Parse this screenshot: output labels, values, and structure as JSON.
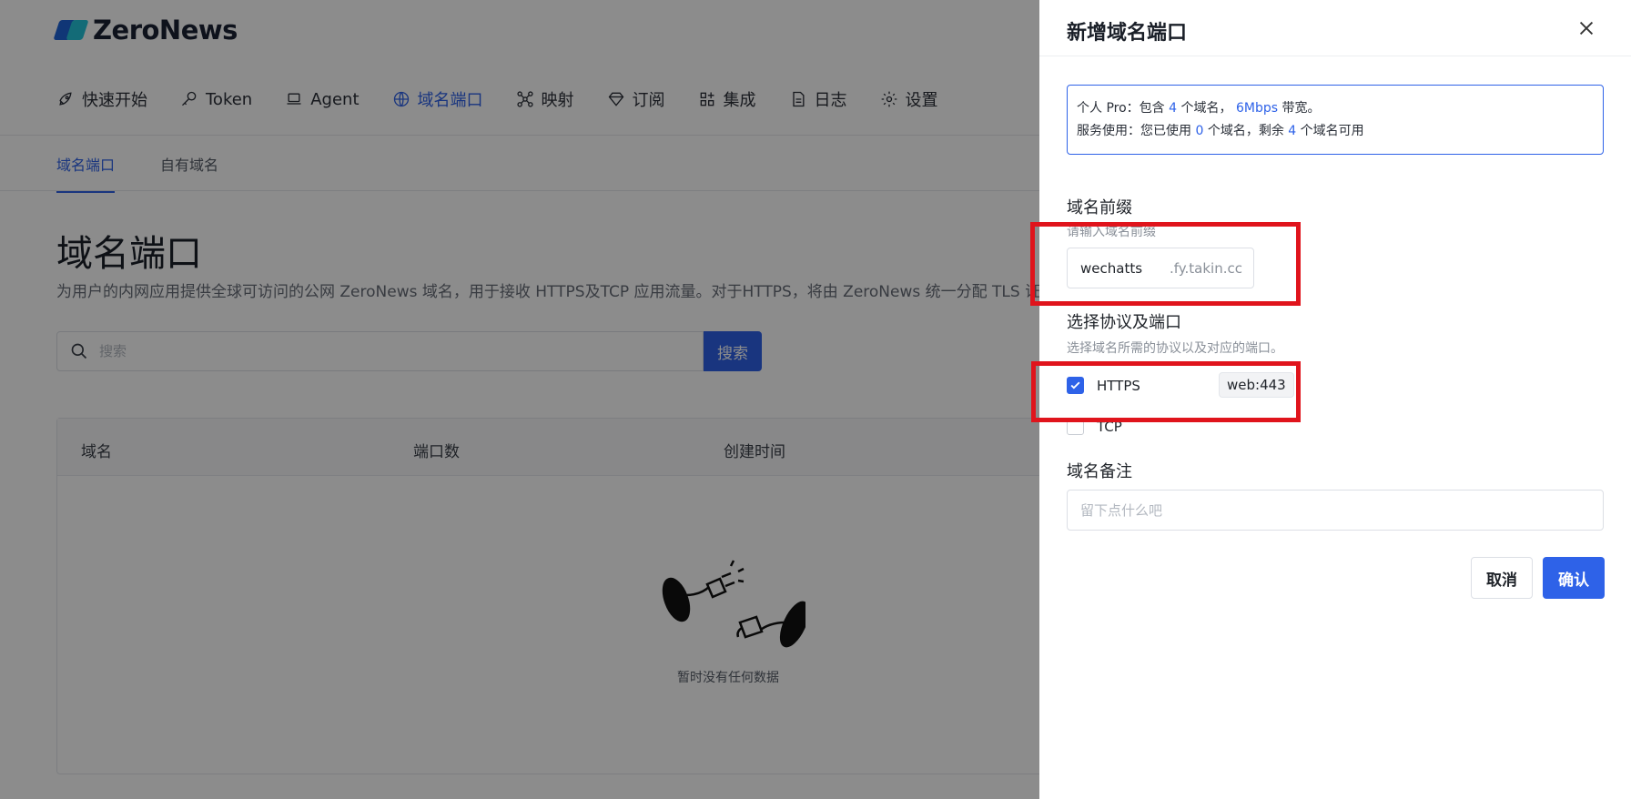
{
  "brand": {
    "name": "ZeroNews"
  },
  "topnav": [
    {
      "label": "快速开始",
      "icon": "rocket-icon"
    },
    {
      "label": "Token",
      "icon": "key-icon"
    },
    {
      "label": "Agent",
      "icon": "laptop-icon"
    },
    {
      "label": "域名端口",
      "icon": "globe-icon",
      "active": true
    },
    {
      "label": "映射",
      "icon": "network-icon"
    },
    {
      "label": "订阅",
      "icon": "diamond-icon"
    },
    {
      "label": "集成",
      "icon": "grid-plus-icon"
    },
    {
      "label": "日志",
      "icon": "document-icon"
    },
    {
      "label": "设置",
      "icon": "gear-icon"
    }
  ],
  "subtabs": [
    {
      "label": "域名端口",
      "active": true
    },
    {
      "label": "自有域名"
    }
  ],
  "page": {
    "title": "域名端口",
    "description": "为用户的内网应用提供全球可访问的公网 ZeroNews 域名，用于接收 HTTPS及TCP 应用流量。对于HTTPS，将由 ZeroNews 统一分配 TLS 证"
  },
  "search": {
    "placeholder": "搜索",
    "button_label": "搜索"
  },
  "table": {
    "columns": [
      "域名",
      "端口数",
      "创建时间"
    ],
    "empty_text": "暂时没有任何数据"
  },
  "drawer": {
    "title": "新增域名端口",
    "info": {
      "line1_a": "个人 Pro：包含 ",
      "line1_count": "4",
      "line1_b": " 个域名， ",
      "line1_bw": "6Mbps",
      "line1_c": " 带宽。",
      "line2_a": "服务使用：您已使用 ",
      "line2_used": "0",
      "line2_b": " 个域名，剩余 ",
      "line2_left": "4",
      "line2_c": " 个域名可用"
    },
    "prefix": {
      "label": "域名前缀",
      "hint": "请输入域名前缀",
      "value": "wechatts",
      "suffix": ".fy.takin.cc"
    },
    "protocol": {
      "label": "选择协议及端口",
      "hint": "选择域名所需的协议以及对应的端口。",
      "options": [
        {
          "label": "HTTPS",
          "checked": true,
          "port": "web:443"
        },
        {
          "label": "TCP",
          "checked": false
        }
      ]
    },
    "note": {
      "label": "域名备注",
      "placeholder": "留下点什么吧"
    },
    "cancel_label": "取消",
    "confirm_label": "确认"
  },
  "colors": {
    "accent": "#2e62e8",
    "highlight_red": "#e0141c"
  }
}
